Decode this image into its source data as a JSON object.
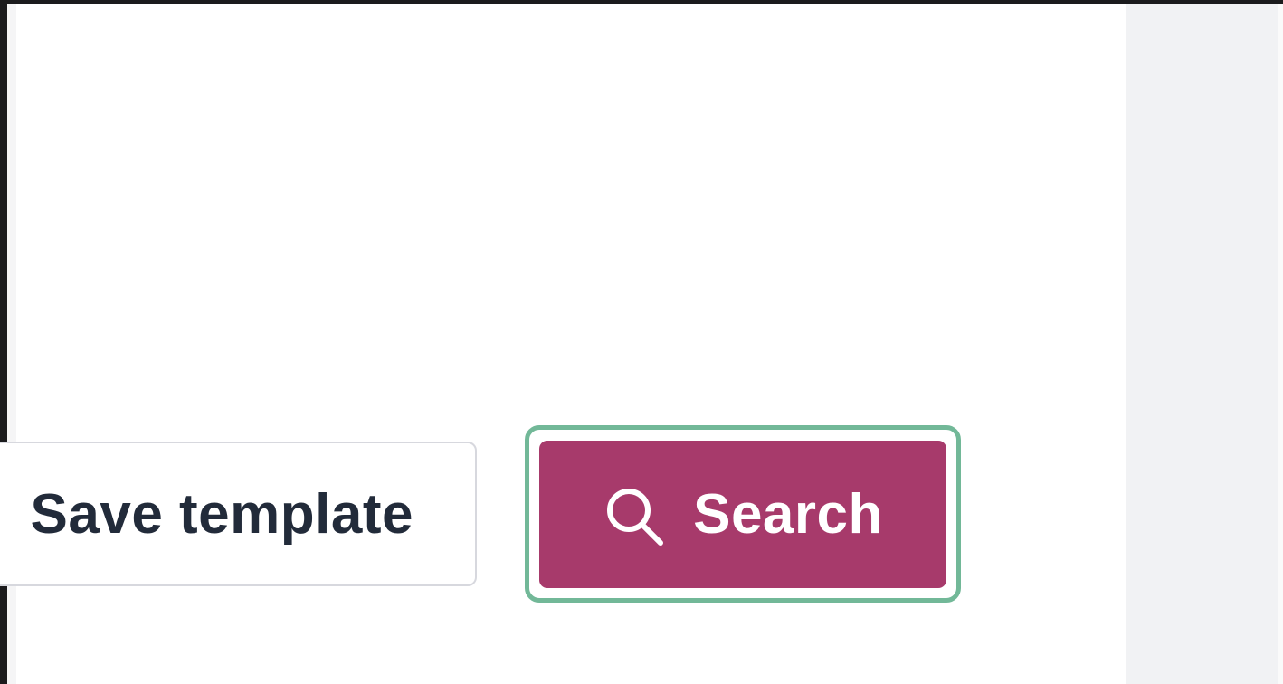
{
  "form_actions": {
    "save_template_label": "Save template",
    "search_label": "Search",
    "search_icon": "search-icon"
  },
  "colors": {
    "primary_button": "#a73a6b",
    "focus_ring": "#72b898",
    "secondary_button_border": "#d7d8de",
    "secondary_button_text": "#222b3a",
    "page_background": "#ffffff",
    "side_gutter": "#f1f2f4"
  }
}
